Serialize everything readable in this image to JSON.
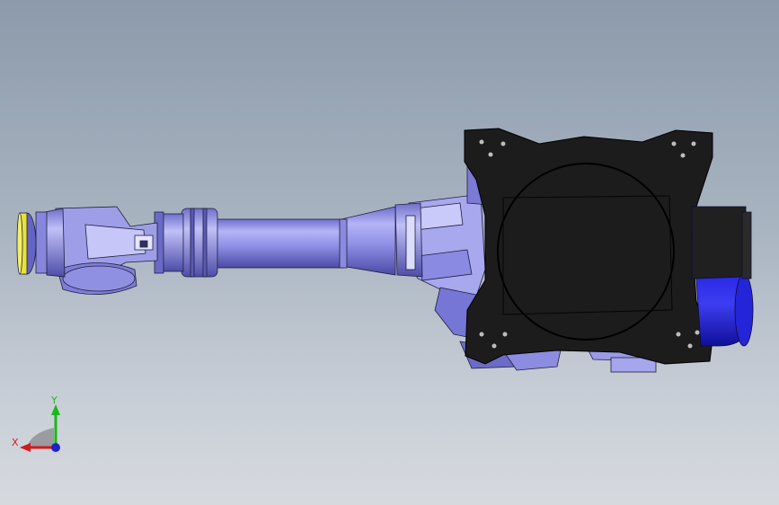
{
  "viewport": {
    "background_top": "#8c9aab",
    "background_bottom": "#d6dadf"
  },
  "model": {
    "type": "robot-arm-assembly",
    "colors": {
      "body_light": "#a9a9f2",
      "body_mid": "#7d7de0",
      "body_dark": "#4c4ca8",
      "base_plate": "#1a1a1a",
      "motor_blue": "#1c1cd8",
      "flange_yellow": "#e8e23a",
      "edge": "#1e1e3c"
    }
  },
  "triad": {
    "x_label": "X",
    "y_label": "Y",
    "x_color": "#d41a1a",
    "y_color": "#18b818",
    "z_color": "#2020d0"
  }
}
